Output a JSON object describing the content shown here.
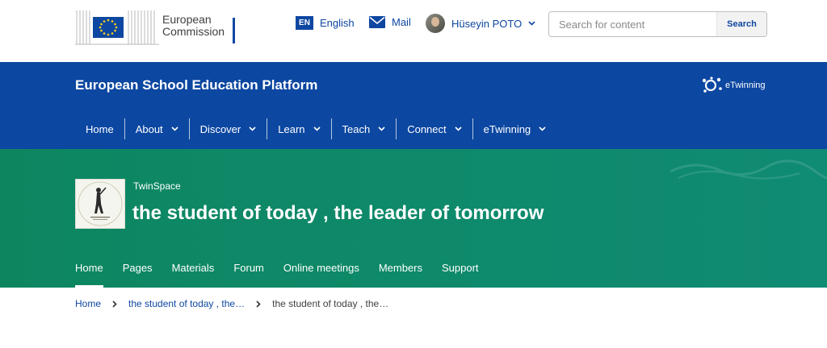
{
  "header": {
    "logo_line1": "European",
    "logo_line2": "Commission",
    "language": {
      "code": "EN",
      "label": "English"
    },
    "mail_label": "Mail",
    "user_name": "Hüseyin POTO",
    "search": {
      "placeholder": "Search for content",
      "button_label": "Search"
    }
  },
  "site": {
    "title": "European School Education Platform",
    "etwinning_logo_text": "eTwinning"
  },
  "main_nav": [
    {
      "label": "Home"
    },
    {
      "label": "About"
    },
    {
      "label": "Discover"
    },
    {
      "label": "Learn"
    },
    {
      "label": "Teach"
    },
    {
      "label": "Connect"
    },
    {
      "label": "eTwinning"
    }
  ],
  "space": {
    "type_label": "TwinSpace",
    "title": "the student of today , the leader of tomorrow",
    "tabs": [
      {
        "label": "Home"
      },
      {
        "label": "Pages"
      },
      {
        "label": "Materials"
      },
      {
        "label": "Forum"
      },
      {
        "label": "Online meetings"
      },
      {
        "label": "Members"
      },
      {
        "label": "Support"
      }
    ]
  },
  "breadcrumb": {
    "home": "Home",
    "parent": "the student of today , the…",
    "current": "the student of today , the…"
  },
  "colors": {
    "brand_blue": "#0c47a1",
    "space_green": "#0e8a6c"
  }
}
